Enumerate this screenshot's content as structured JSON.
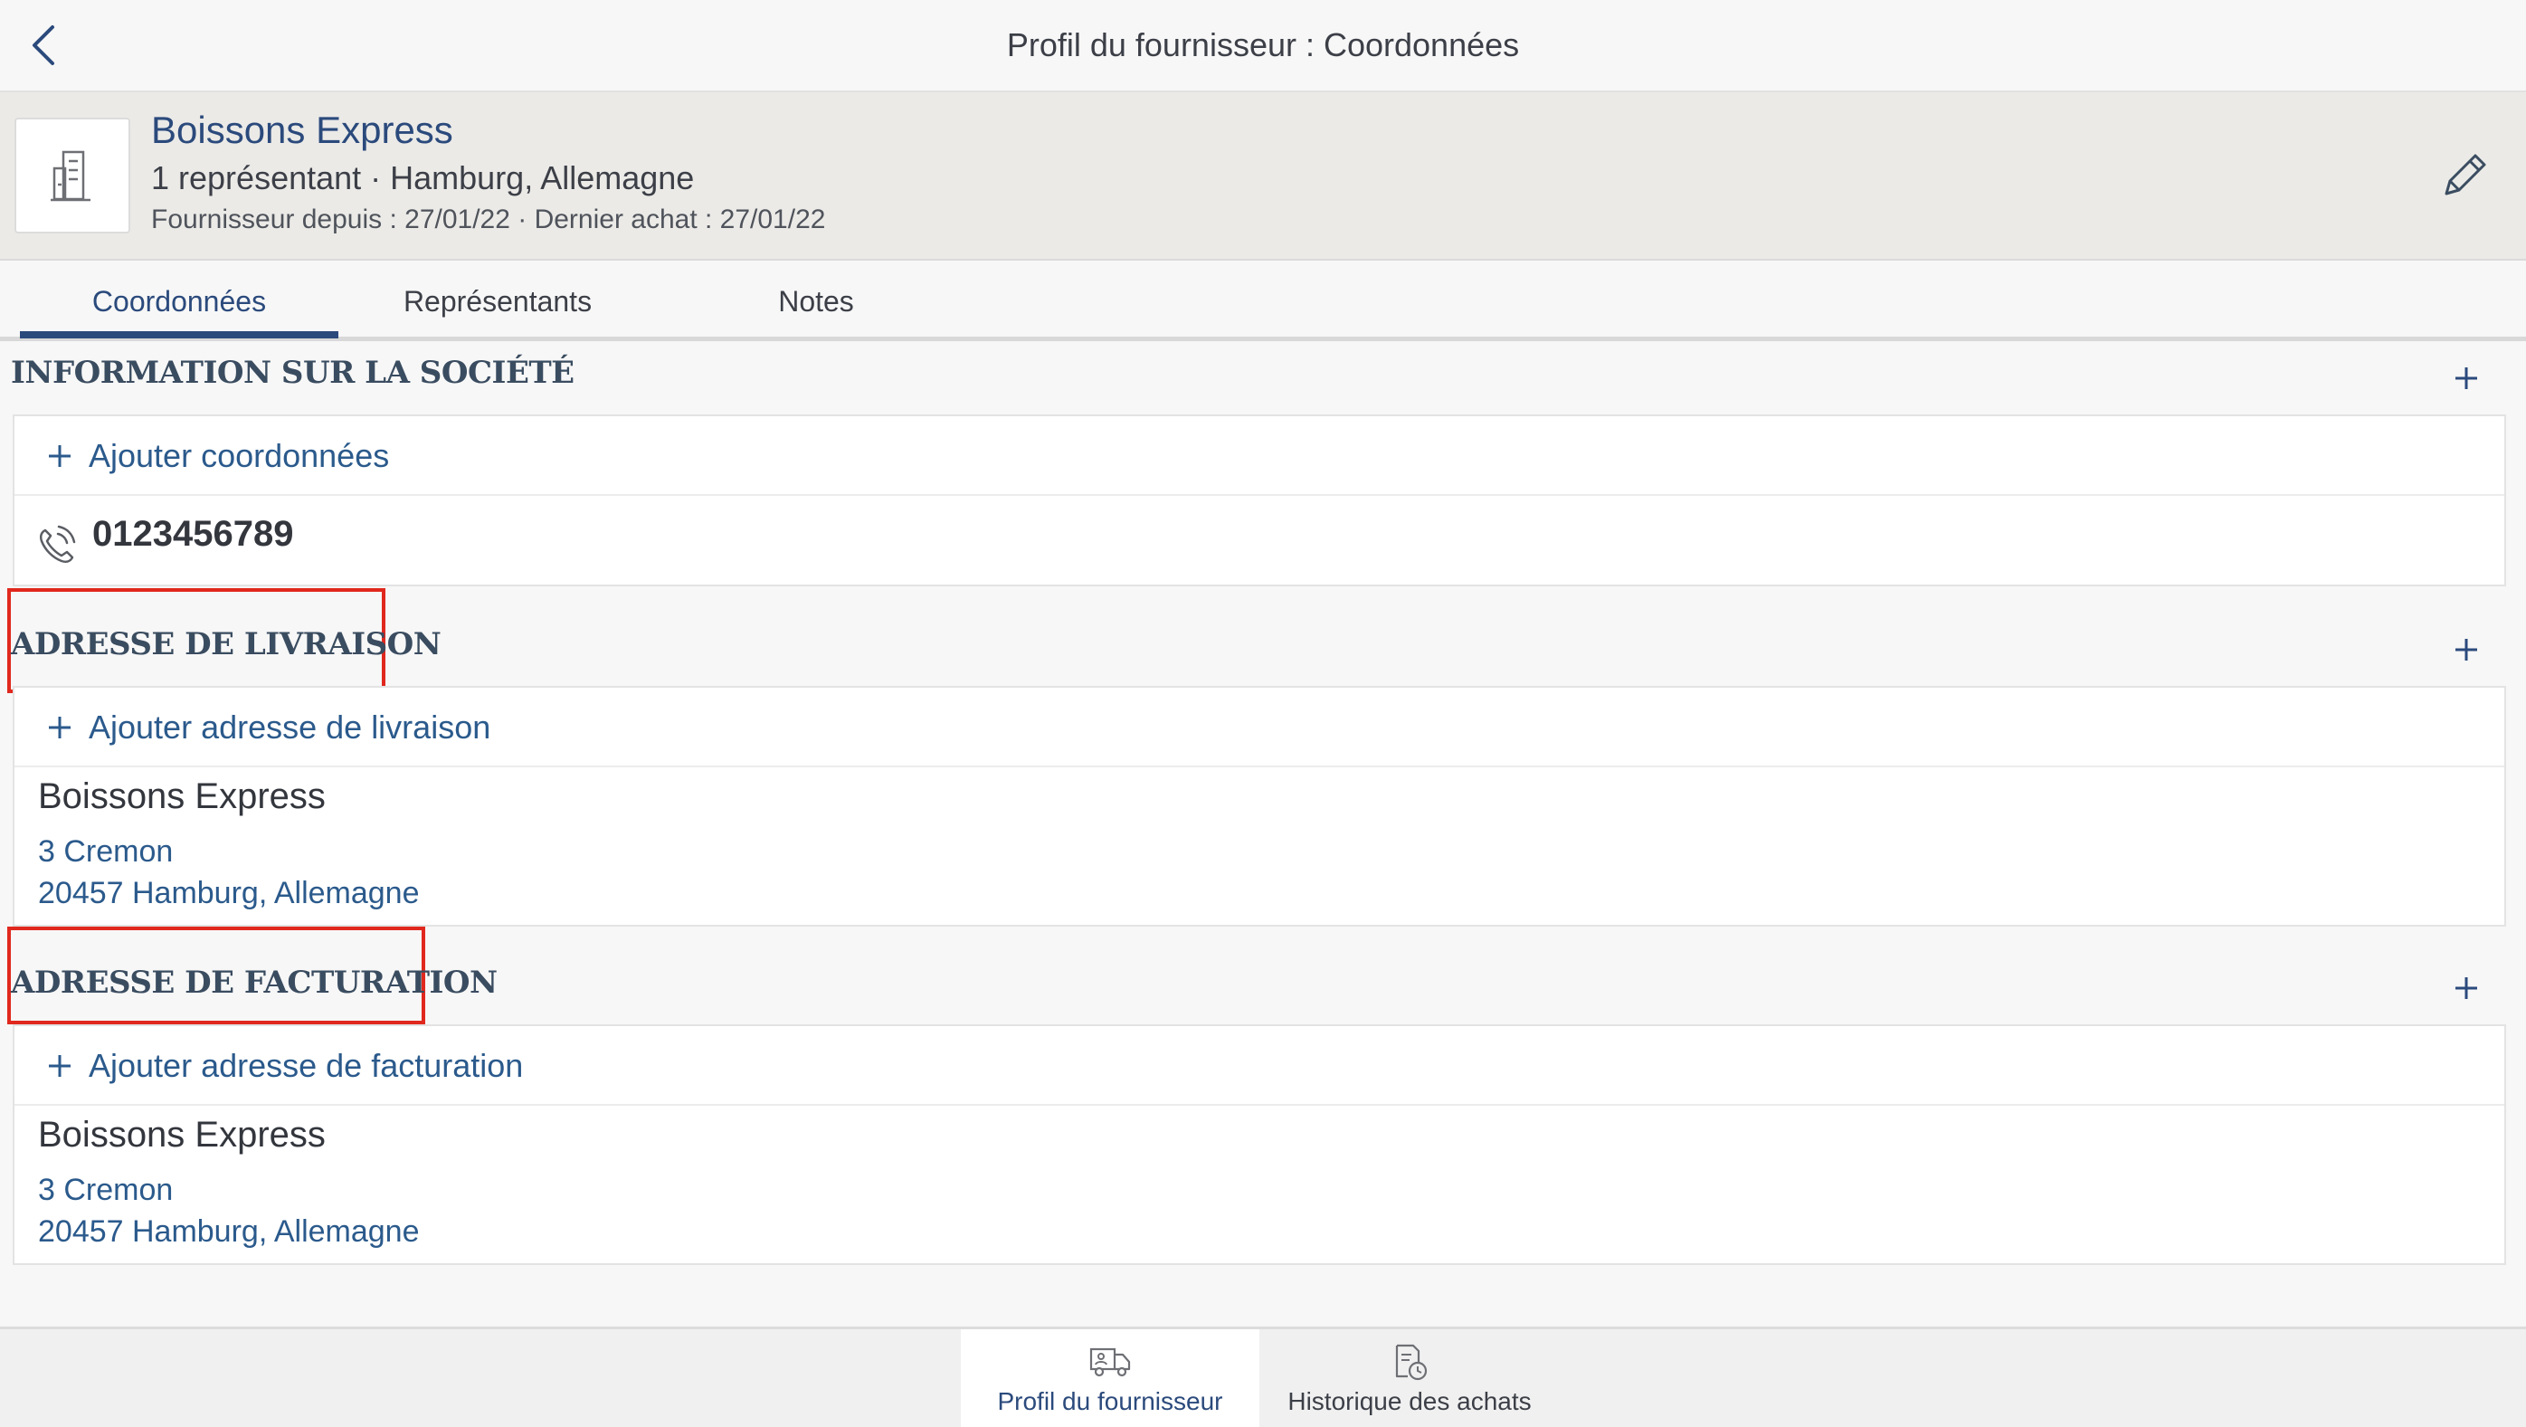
{
  "header": {
    "title": "Profil du fournisseur : Coordonnées",
    "back_icon": "chevron-left-icon"
  },
  "supplier": {
    "name": "Boissons Express",
    "subtitle": "1 représentant · Hamburg, Allemagne",
    "meta": "Fournisseur depuis : 27/01/22 · Dernier achat : 27/01/22",
    "avatar_icon": "building-icon",
    "edit_icon": "pencil-icon"
  },
  "tabs": [
    {
      "label": "Coordonnées",
      "active": true
    },
    {
      "label": "Représentants",
      "active": false
    },
    {
      "label": "Notes",
      "active": false
    }
  ],
  "company_info": {
    "title": "INFORMATION SUR LA SOCIÉTÉ",
    "add_label": "Ajouter coordonnées",
    "phone": "0123456789"
  },
  "delivery": {
    "title": "ADRESSE DE LIVRAISON",
    "add_label": "Ajouter adresse de livraison",
    "name": "Boissons Express",
    "street": "3 Cremon",
    "city": "20457 Hamburg, Allemagne"
  },
  "billing": {
    "title": "ADRESSE DE FACTURATION",
    "add_label": "Ajouter adresse de facturation",
    "name": "Boissons Express",
    "street": "3 Cremon",
    "city": "20457 Hamburg, Allemagne"
  },
  "bottom_nav": [
    {
      "label": "Profil du fournisseur",
      "icon": "truck-profile-icon",
      "active": true
    },
    {
      "label": "Historique des achats",
      "icon": "purchase-history-icon",
      "active": false
    }
  ],
  "colors": {
    "accent": "#2b4a7c",
    "link": "#2b5a8c",
    "highlight": "#e0281e",
    "header_bg": "#ebeae7"
  }
}
